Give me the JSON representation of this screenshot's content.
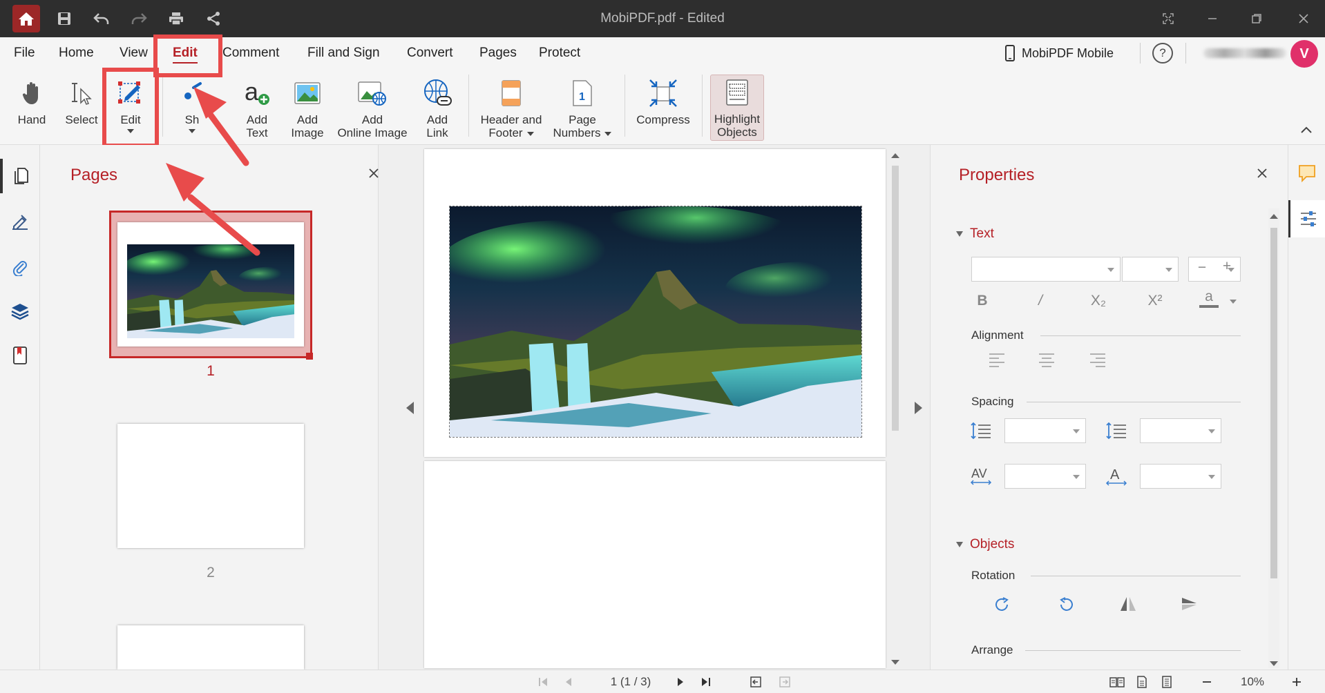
{
  "title_bar": {
    "title": "MobiPDF.pdf - Edited",
    "icons": [
      "home-icon",
      "save-icon",
      "undo-icon",
      "redo-icon",
      "print-icon",
      "share-icon"
    ],
    "window_icons": [
      "fullscreen-icon",
      "minimize-icon",
      "restore-icon",
      "close-icon"
    ]
  },
  "menu": {
    "items": [
      "File",
      "Home",
      "View",
      "Edit",
      "Comment",
      "Fill and Sign",
      "Convert",
      "Pages",
      "Protect"
    ],
    "active": "Edit"
  },
  "account": {
    "mobile_label": "MobiPDF Mobile",
    "help_label": "?",
    "avatar_initial": "V"
  },
  "ribbon": {
    "hand": "Hand",
    "select": "Select",
    "edit": "Edit",
    "shapes": "Sh",
    "add_text_1": "Add",
    "add_text_2": "Text",
    "add_image_1": "Add",
    "add_image_2": "Image",
    "add_online_1": "Add",
    "add_online_2": "Online Image",
    "add_link_1": "Add",
    "add_link_2": "Link",
    "header_1": "Header and",
    "header_2": "Footer",
    "pagenum_1": "Page",
    "pagenum_2": "Numbers",
    "compress": "Compress",
    "highlight_1": "Highlight",
    "highlight_2": "Objects"
  },
  "pages_panel": {
    "title": "Pages",
    "page_numbers": [
      "1",
      "2"
    ]
  },
  "properties": {
    "title": "Properties",
    "text_section": "Text",
    "format_buttons": [
      "B",
      "/",
      "X₂",
      "X²",
      "a"
    ],
    "alignment": "Alignment",
    "spacing": "Spacing",
    "objects_section": "Objects",
    "rotation": "Rotation",
    "arrange": "Arrange"
  },
  "status": {
    "page_indicator": "1 (1 / 3)",
    "zoom": "10%"
  },
  "colors": {
    "accent": "#b52026",
    "annotation": "#e84b4b",
    "titlebar": "#2e2e2e"
  }
}
